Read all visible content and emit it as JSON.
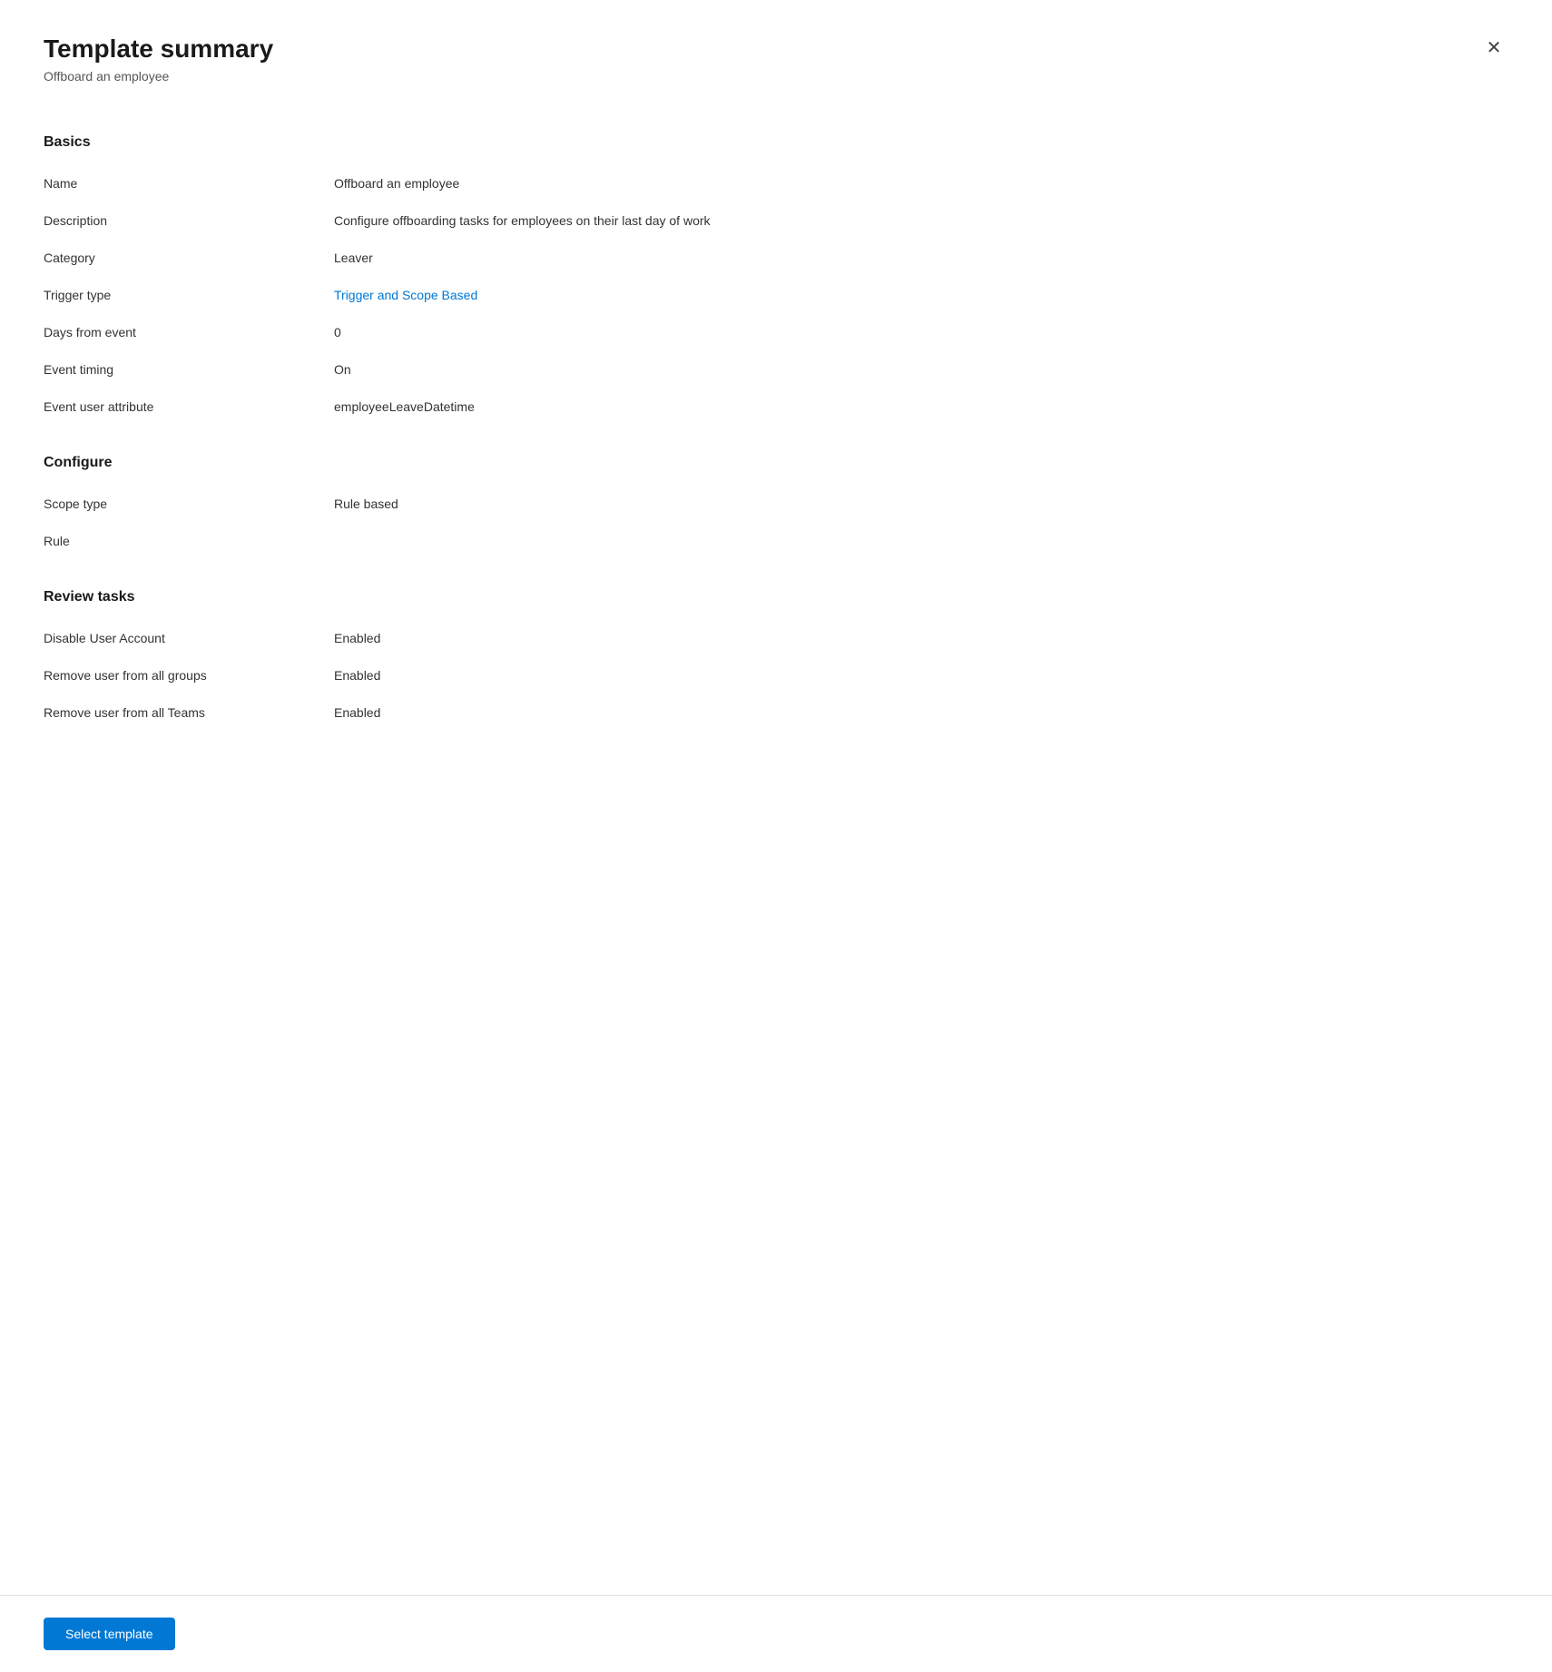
{
  "header": {
    "title": "Template summary",
    "subtitle": "Offboard an employee",
    "close_label": "×"
  },
  "sections": {
    "basics": {
      "heading": "Basics",
      "fields": [
        {
          "label": "Name",
          "value": "Offboard an employee",
          "link": false
        },
        {
          "label": "Description",
          "value": "Configure offboarding tasks for employees on their last day of work",
          "link": false
        },
        {
          "label": "Category",
          "value": "Leaver",
          "link": false
        },
        {
          "label": "Trigger type",
          "value": "Trigger and Scope Based",
          "link": true
        },
        {
          "label": "Days from event",
          "value": "0",
          "link": false
        },
        {
          "label": "Event timing",
          "value": "On",
          "link": false
        },
        {
          "label": "Event user attribute",
          "value": "employeeLeaveDatetime",
          "link": false
        }
      ]
    },
    "configure": {
      "heading": "Configure",
      "fields": [
        {
          "label": "Scope type",
          "value": "Rule based",
          "link": false
        },
        {
          "label": "Rule",
          "value": "",
          "link": false
        }
      ]
    },
    "review_tasks": {
      "heading": "Review tasks",
      "fields": [
        {
          "label": "Disable User Account",
          "value": "Enabled",
          "link": true
        },
        {
          "label": "Remove user from all groups",
          "value": "Enabled",
          "link": true
        },
        {
          "label": "Remove user from all Teams",
          "value": "Enabled",
          "link": true
        }
      ]
    }
  },
  "footer": {
    "select_template_label": "Select template"
  }
}
